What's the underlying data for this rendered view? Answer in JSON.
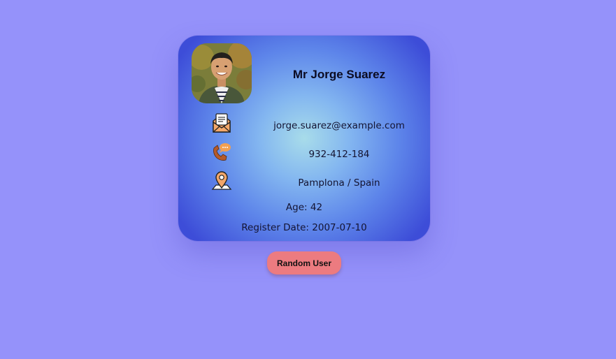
{
  "user": {
    "name": "Mr Jorge Suarez",
    "email": "jorge.suarez@example.com",
    "phone": "932-412-184",
    "location": "Pamplona / Spain",
    "age": "Age: 42",
    "register_date": "Register Date: 2007-07-10"
  },
  "actions": {
    "random_user_label": "Random User"
  },
  "icons": {
    "email": "envelope-letter-icon",
    "phone": "phone-chat-icon",
    "location": "map-pin-icon"
  },
  "colors": {
    "page_background": "#9592fa",
    "card_center": "#a8dcea",
    "card_edge": "#3d4dd8",
    "button": "#ec7b80"
  }
}
